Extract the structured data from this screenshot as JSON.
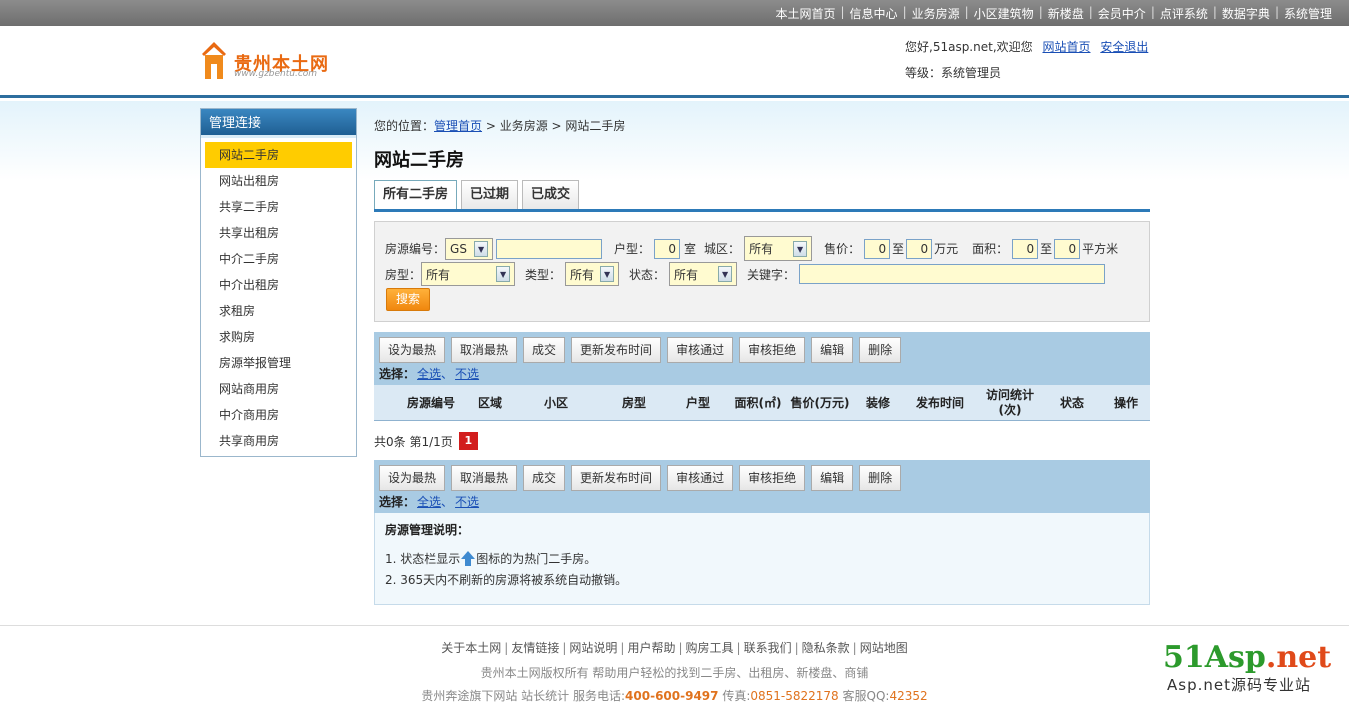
{
  "topnav": [
    "本土网首页",
    "信息中心",
    "业务房源",
    "小区建筑物",
    "新楼盘",
    "会员中介",
    "点评系统",
    "数据字典",
    "系统管理"
  ],
  "header": {
    "logo_text": "贵州本土网",
    "logo_sub": "www.gzbentu.com",
    "greeting": "您好,51asp.net,欢迎您",
    "home_link": "网站首页",
    "logout_link": "安全退出",
    "level": "等级：系统管理员"
  },
  "sidebar": {
    "title": "管理连接",
    "items": [
      "网站二手房",
      "网站出租房",
      "共享二手房",
      "共享出租房",
      "中介二手房",
      "中介出租房",
      "求租房",
      "求购房",
      "房源举报管理",
      "网站商用房",
      "中介商用房",
      "共享商用房"
    ]
  },
  "breadcrumb": {
    "prefix": "您的位置：",
    "home": "管理首页",
    "rest": " > 业务房源 > 网站二手房"
  },
  "page_title": "网站二手房",
  "tabs": [
    "所有二手房",
    "已过期",
    "已成交"
  ],
  "search": {
    "code_label": "房源编号：",
    "code_prefix": "GS",
    "code_value": "",
    "huxing_label": "户型：",
    "huxing_value": "0",
    "room_unit": "室",
    "district_label": "城区：",
    "district_value": "所有",
    "price_label": "售价：",
    "price_min": "0",
    "to1": "至",
    "price_max": "0",
    "price_unit": "万元",
    "area_label": "面积：",
    "area_min": "0",
    "to2": "至",
    "area_max": "0",
    "area_unit": "平方米",
    "type_label": "房型：",
    "type_value": "所有",
    "kind_label": "类型：",
    "kind_value": "所有",
    "status_label": "状态：",
    "status_value": "所有",
    "keyword_label": "关键字：",
    "keyword_value": "",
    "search_button": "搜索"
  },
  "actions": {
    "buttons": [
      "设为最热",
      "取消最热",
      "成交",
      "更新发布时间",
      "审核通过",
      "审核拒绝",
      "编辑",
      "删除"
    ],
    "select_label": "选择：",
    "select_all": "全选",
    "sep": "、",
    "select_none": "不选"
  },
  "table": {
    "headers": [
      "房源编号",
      "区域",
      "小区",
      "房型",
      "户型",
      "面积(㎡)",
      "售价(万元)",
      "装修",
      "发布时间",
      "访问统计(次)",
      "状态",
      "操作"
    ]
  },
  "pager": {
    "text": "共0条 第1/1页",
    "page": "1"
  },
  "notes": {
    "title": "房源管理说明：",
    "note1_before": "1. 状态栏显示",
    "note1_after": "图标的为热门二手房。",
    "note2": "2. 365天内不刷新的房源将被系统自动撤销。"
  },
  "footer": {
    "links": [
      "关于本土网",
      "友情链接",
      "网站说明",
      "用户帮助",
      "购房工具",
      "联系我们",
      "隐私条款",
      "网站地图"
    ],
    "copyright": "贵州本土网版权所有 帮助用户轻松的找到二手房、出租房、新楼盘、商铺",
    "contact_prefix": "贵州奔途旗下网站 站长统计 服务电话:",
    "phone": "400-600-9497",
    "fax_label": " 传真:",
    "fax": "0851-5822178",
    "qq_label": " 客服QQ:",
    "qq": "42352"
  },
  "watermark": {
    "main_a": "51Asp",
    "main_b": ".net",
    "sub": "Asp.net源码专业站"
  }
}
